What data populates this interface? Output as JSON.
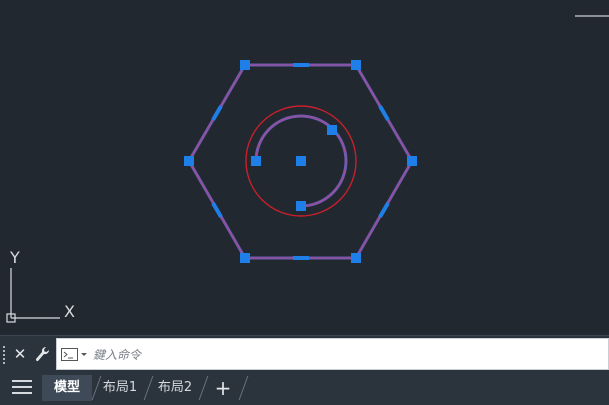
{
  "viewport": {
    "ucs": {
      "y_label": "Y",
      "x_label": "X"
    }
  },
  "command_line": {
    "close_icon": "close-icon",
    "customize_icon": "wrench-icon",
    "prompt_icon": "command-prompt-icon",
    "placeholder": "鍵入命令",
    "value": ""
  },
  "layout_tabs": {
    "menu_icon": "hamburger-menu-icon",
    "tabs": [
      {
        "label": "模型",
        "active": true
      },
      {
        "label": "布局1",
        "active": false
      },
      {
        "label": "布局2",
        "active": false
      }
    ],
    "add_label": "+"
  },
  "colors": {
    "background": "#212830",
    "geometry": "#6c5bb0",
    "grip": "#1f7fe8",
    "circle": "#c8202c",
    "bar": "#2b333d"
  }
}
